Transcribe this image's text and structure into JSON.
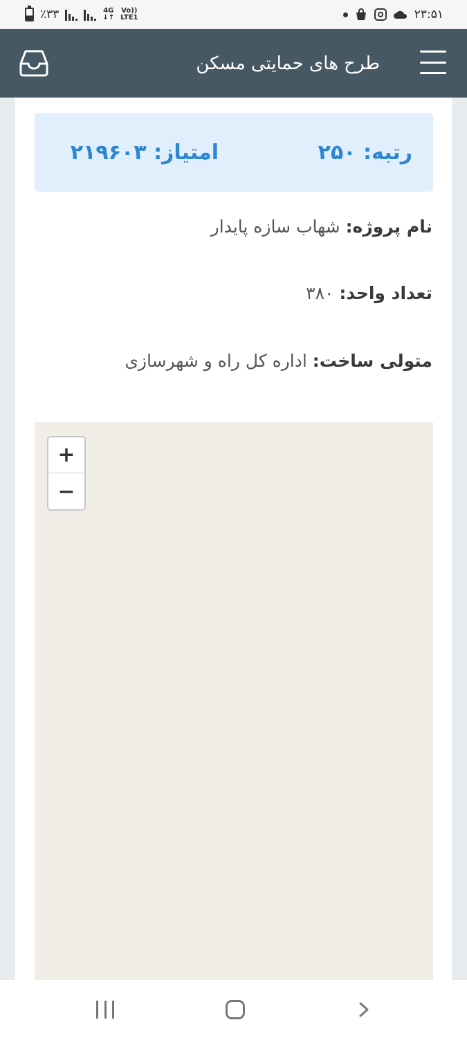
{
  "status_bar": {
    "time": "۲۳:۵۱",
    "battery": "٪۳۳",
    "network": "4G",
    "volte_top": "Vo))",
    "volte_bottom": "LTE1"
  },
  "app_bar": {
    "title": "طرح های حمایتی مسکن"
  },
  "score_card": {
    "rank": "رتبه: ۲۵۰",
    "score": "امتیاز: ۲۱۹۶۰۳"
  },
  "project": {
    "name_label": "نام پروژه:",
    "name_value": "شهاب سازه پایدار",
    "units_label": "تعداد واحد:",
    "units_value": "۳۸۰",
    "builder_label": "متولی ساخت:",
    "builder_value": "اداره کل راه و شهرسازی"
  },
  "map": {
    "zoom_in": "+",
    "zoom_out": "−"
  },
  "colors": {
    "app_bar": "#465863",
    "accent": "#2d86d0",
    "card_bg": "#e1effc"
  }
}
